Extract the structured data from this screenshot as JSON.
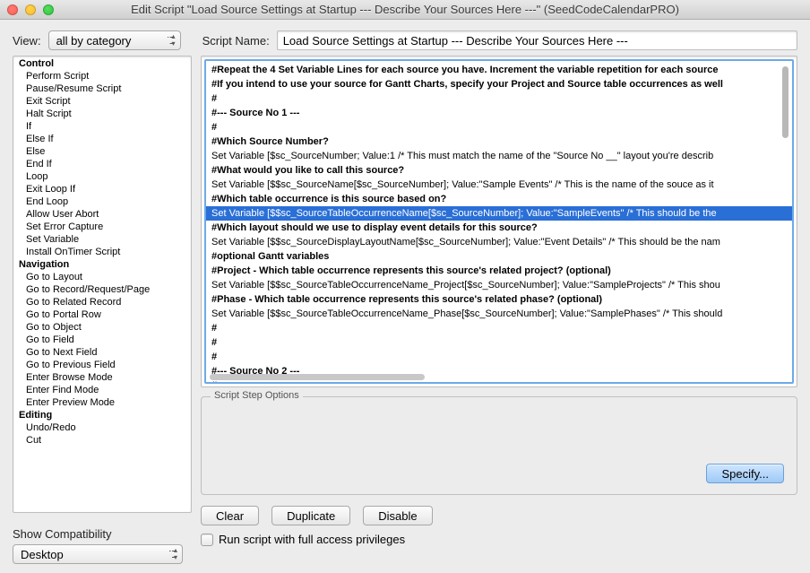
{
  "window": {
    "title": "Edit Script \"Load Source Settings at Startup --- Describe Your Sources Here ---\" (SeedCodeCalendarPRO)"
  },
  "view": {
    "label": "View:",
    "value": "all by category"
  },
  "scriptName": {
    "label": "Script Name:",
    "value": "Load Source Settings at Startup --- Describe Your Sources Here ---"
  },
  "stepsList": {
    "groups": [
      {
        "name": "Control",
        "items": [
          "Perform Script",
          "Pause/Resume Script",
          "Exit Script",
          "Halt Script",
          "If",
          "Else If",
          "Else",
          "End If",
          "Loop",
          "Exit Loop If",
          "End Loop",
          "Allow User Abort",
          "Set Error Capture",
          "Set Variable",
          "Install OnTimer Script"
        ]
      },
      {
        "name": "Navigation",
        "items": [
          "Go to Layout",
          "Go to Record/Request/Page",
          "Go to Related Record",
          "Go to Portal Row",
          "Go to Object",
          "Go to Field",
          "Go to Next Field",
          "Go to Previous Field",
          "Enter Browse Mode",
          "Enter Find Mode",
          "Enter Preview Mode"
        ]
      },
      {
        "name": "Editing",
        "items": [
          "Undo/Redo",
          "Cut"
        ]
      }
    ]
  },
  "scriptLines": [
    {
      "t": "#Repeat the 4 Set Variable Lines for each source you have. Increment the variable repetition for each source",
      "b": true
    },
    {
      "t": "#If you intend to use your source for Gantt Charts, specify your Project and Source table occurrences as well",
      "b": true
    },
    {
      "t": "#",
      "b": true
    },
    {
      "t": "#--- Source No 1 ---",
      "b": true
    },
    {
      "t": "#",
      "b": true
    },
    {
      "t": "#Which Source Number?",
      "b": true
    },
    {
      "t": "Set Variable [$sc_SourceNumber; Value:1  /*  This must match the name of the \"Source No __\" layout you're describ"
    },
    {
      "t": "#What would you like to call this source?",
      "b": true
    },
    {
      "t": "Set Variable [$$sc_SourceName[$sc_SourceNumber]; Value:\"Sample Events\"   /*  This is the name of the souce as it"
    },
    {
      "t": "#Which table occurrence is this source based on?",
      "b": true
    },
    {
      "t": "Set Variable [$$sc_SourceTableOccurrenceName[$sc_SourceNumber]; Value:\"SampleEvents\"   /*  This should be the",
      "sel": true
    },
    {
      "t": "#Which layout should we use to display event details for this source?",
      "b": true
    },
    {
      "t": "Set Variable [$$sc_SourceDisplayLayoutName[$sc_SourceNumber]; Value:\"Event Details\"   /*  This should be the nam"
    },
    {
      "t": "#optional Gantt variables",
      "b": true
    },
    {
      "t": "#Project - Which table occurrence represents this source's related project? (optional)",
      "b": true
    },
    {
      "t": "Set Variable [$$sc_SourceTableOccurrenceName_Project[$sc_SourceNumber]; Value:\"SampleProjects\"   /*  This shou"
    },
    {
      "t": "#Phase - Which table occurrence represents this source's related phase? (optional)",
      "b": true
    },
    {
      "t": "Set Variable [$$sc_SourceTableOccurrenceName_Phase[$sc_SourceNumber]; Value:\"SamplePhases\"   /*  This should"
    },
    {
      "t": "#",
      "b": true
    },
    {
      "t": "#",
      "b": true
    },
    {
      "t": "#",
      "b": true
    },
    {
      "t": "#--- Source No 2 ---",
      "b": true
    },
    {
      "t": "#",
      "b": true
    }
  ],
  "optionsBox": {
    "title": "Script Step Options",
    "specify": "Specify..."
  },
  "buttons": {
    "clear": "Clear",
    "duplicate": "Duplicate",
    "disable": "Disable"
  },
  "compat": {
    "label": "Show Compatibility",
    "value": "Desktop"
  },
  "fullAccess": {
    "label": "Run script with full access privileges",
    "checked": false
  }
}
